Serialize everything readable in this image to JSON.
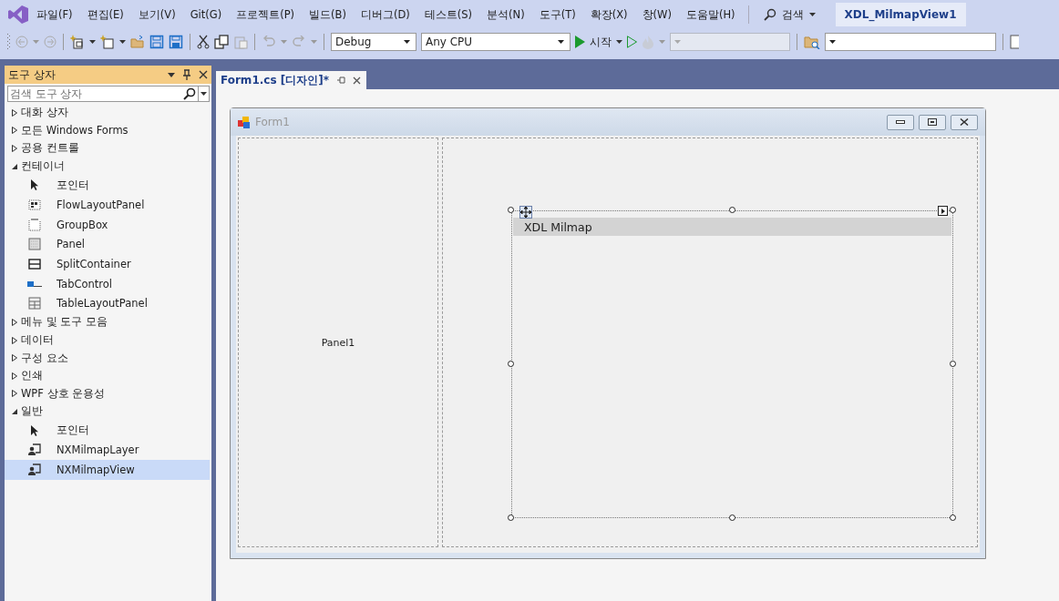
{
  "menu": {
    "items": [
      "파일(F)",
      "편집(E)",
      "보기(V)",
      "Git(G)",
      "프로젝트(P)",
      "빌드(B)",
      "디버그(D)",
      "테스트(S)",
      "분석(N)",
      "도구(T)",
      "확장(X)",
      "창(W)",
      "도움말(H)"
    ],
    "search": "검색",
    "solution_title": "XDL_MilmapView1"
  },
  "toolbar": {
    "configuration": "Debug",
    "platform": "Any CPU",
    "start": "시작"
  },
  "toolbox": {
    "title": "도구 상자",
    "search_placeholder": "검색 도구 상자",
    "groups": [
      {
        "label": "대화 상자",
        "expanded": false
      },
      {
        "label": "모든 Windows Forms",
        "expanded": false
      },
      {
        "label": "공용 컨트롤",
        "expanded": false
      },
      {
        "label": "컨테이너",
        "expanded": true,
        "children": [
          {
            "label": "포인터",
            "kind": "pointer",
            "selected": false
          },
          {
            "label": "FlowLayoutPanel",
            "kind": "flow",
            "selected": false
          },
          {
            "label": "GroupBox",
            "kind": "group",
            "selected": false
          },
          {
            "label": "Panel",
            "kind": "panel",
            "selected": false
          },
          {
            "label": "SplitContainer",
            "kind": "split",
            "selected": false
          },
          {
            "label": "TabControl",
            "kind": "tab",
            "selected": false
          },
          {
            "label": "TableLayoutPanel",
            "kind": "table",
            "selected": false
          }
        ]
      },
      {
        "label": "메뉴 및 도구 모음",
        "expanded": false
      },
      {
        "label": "데이터",
        "expanded": false
      },
      {
        "label": "구성 요소",
        "expanded": false
      },
      {
        "label": "인쇄",
        "expanded": false
      },
      {
        "label": "WPF 상호 운용성",
        "expanded": false
      },
      {
        "label": "일반",
        "expanded": true,
        "children": [
          {
            "label": "포인터",
            "kind": "pointer",
            "selected": false
          },
          {
            "label": "NXMilmapLayer",
            "kind": "user",
            "selected": false
          },
          {
            "label": "NXMilmapView",
            "kind": "user",
            "selected": true
          }
        ]
      }
    ]
  },
  "document_tab": {
    "title": "Form1.cs [디자인]*",
    "selected": true
  },
  "form": {
    "title": "Form1",
    "panel_label": "Panel1",
    "control_title": "XDL Milmap"
  }
}
